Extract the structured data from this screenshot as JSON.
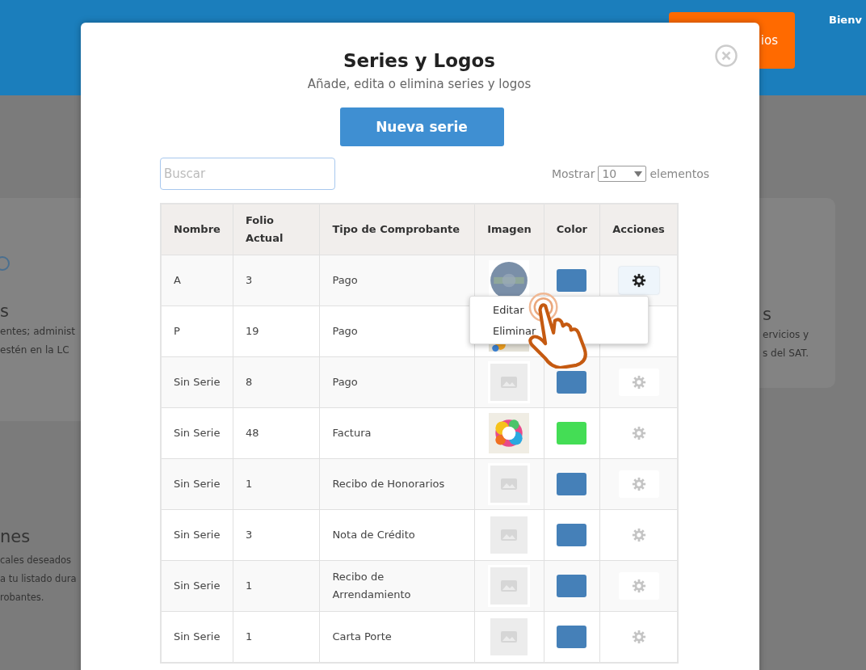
{
  "background": {
    "header_button": "ios",
    "greeting": "Bienv",
    "left_cards": [
      {
        "title": "s",
        "lines": [
          "entes; administ",
          "estén en la LC"
        ]
      },
      {
        "title": "nes",
        "lines": [
          "cales deseados",
          "a tu listado dura",
          "robantes."
        ]
      }
    ],
    "right_card": {
      "title": "s",
      "lines": [
        "ervicios y",
        "s del SAT."
      ]
    }
  },
  "modal": {
    "title": "Series y Logos",
    "subtitle": "Añade, edita o elimina series y logos",
    "new_button": "Nueva serie",
    "search": {
      "placeholder": "Buscar"
    },
    "page_size": {
      "label_before": "Mostrar",
      "value": "10",
      "label_after": "elementos"
    },
    "table": {
      "columns": [
        "Nombre",
        "Folio Actual",
        "Tipo de Comprobante",
        "Imagen",
        "Color",
        "Acciones"
      ],
      "rows": [
        {
          "name": "A",
          "folio": "3",
          "type": "Pago",
          "color": "#4580b8",
          "actions": {
            "selected": true
          }
        },
        {
          "name": "P",
          "folio": "19",
          "type": "Pago"
        },
        {
          "name": "Sin Serie",
          "folio": "8",
          "type": "Pago",
          "image": {
            "kind": "placeholder"
          },
          "color": "#4580b8",
          "actions": {
            "selected": false
          }
        },
        {
          "name": "Sin Serie",
          "folio": "48",
          "type": "Factura",
          "color": "#44dd55",
          "actions": {
            "selected": false
          }
        },
        {
          "name": "Sin Serie",
          "folio": "1",
          "type": "Recibo de Honorarios",
          "image": {
            "kind": "placeholder"
          },
          "color": "#4580b8",
          "actions": {
            "selected": false
          }
        },
        {
          "name": "Sin Serie",
          "folio": "3",
          "type": "Nota de Crédito",
          "image": {
            "kind": "placeholder"
          },
          "color": "#4580b8",
          "actions": {
            "selected": false
          }
        },
        {
          "name": "Sin Serie",
          "folio": "1",
          "type": "Recibo de Arrendamiento",
          "image": {
            "kind": "placeholder"
          },
          "color": "#4580b8",
          "actions": {
            "selected": false
          }
        },
        {
          "name": "Sin Serie",
          "folio": "1",
          "type": "Carta Porte",
          "image": {
            "kind": "placeholder"
          },
          "color": "#4580b8",
          "actions": {
            "selected": false
          }
        }
      ]
    },
    "menu": {
      "items": [
        "Editar",
        "Eliminar"
      ]
    }
  }
}
